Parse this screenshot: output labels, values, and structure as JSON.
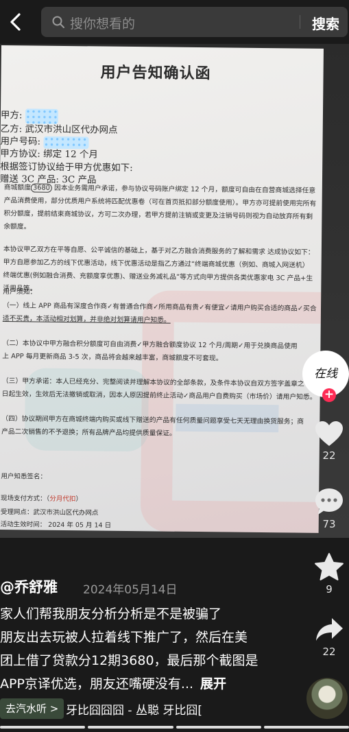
{
  "topbar": {
    "back_icon": "chevron-left-icon",
    "search_placeholder": "搜你想看的",
    "search_button": "搜索"
  },
  "document": {
    "title": "用户告知确认函",
    "party_a_label": "甲方:",
    "party_b": "乙方: 武汉市洪山区代办网点",
    "user_no_label": "用户号码:",
    "party_a_agreement": "甲方协议: 绑定 12 个月",
    "basis": "根据签订协议给于甲方优惠如下:",
    "gift": "赠送 3C 产品: 3C 产品",
    "p1_a": "商城额度",
    "p1_amount": "3680",
    "p1_b": "因本业务需用户承诺，参与协议号码账户绑定 12 个月，额度可自由在自营商城选择任意",
    "p1_c": "产品消费使用，部分优质用户系统将匹配优惠卷（可在首页抵扣部分额度使用）。甲方亦可提前使用完所有",
    "p1_d": "积分额度，提前结束商城协议，方可二次办理，若甲方提前注销或变更及注销号码则视为自动放弃所有剩",
    "p1_e": "余额度。",
    "p2_a": "本协议甲乙双方在平等自愿、公平诚信的基础上，基于对乙方融合消费服务的了解和需求  达成协议如下：",
    "p2_b": "甲方自愿参加乙方的线下优惠活动，线下优惠活动是指乙方通过“终端商城优惠（例如、商城入网送机）",
    "p2_c": "终端优惠(例如融合消费、充额度享优惠)、赠送业务减礼品”等方式向甲方提供各类优惠家电 3C 产品+生",
    "p2_d": "活用品等。",
    "notice_title": "用户须知：",
    "n1_a": "（一）线上 APP 商品有深度合作商✓有普通合作商✓所用商品有贵✓有便宜✓请用户购买合适的商品✓买合",
    "n1_b": "适不买贵，本活动相对划算，并非绝对划算请用户知悉。",
    "n2_a": "（二）本协议中甲方融合积分额度可自由消费✓甲方融合额度协议 12 个月/周期✓用于兑换商品使用",
    "n2_b": "上 APP 每月更新商品  3-5 次，商品将会越来越丰富，商城额度不可套现。",
    "n3_a": "（三）甲方承诺：本人已经充分、完整阅读并理解本协议的全部条款，及条件本协议自双方签字盖章之",
    "n3_b": "日起生效，生效后无法撤销或取消，因本人原因提前终止活动✓商品用户自费购买（市场价）请用户知悉。",
    "n4_a": "（四）协议期间甲方在商城终端内购买或线下赠送的产品有任何质量问题享受七天无理由换货服务；商",
    "n4_b": "产品二次销售的不予退换；所有品牌产品均提供质量保证。",
    "sign_label": "用户知悉签名：",
    "pay_label": "现场支付方式：（",
    "pay_value": "分月代扣",
    "pay_end": "）",
    "venue": "受理网点：武汉市洪山区代办网点",
    "effective": "活动生效时间：  2024 年 05 月 14 日"
  },
  "actions": {
    "avatar_text": "在线",
    "follow": "+",
    "like_count": "22",
    "comment_count": "73",
    "favorite_count": "9",
    "share_count": "22"
  },
  "post": {
    "author": "@乔舒雅",
    "date": "2024年05月14日",
    "desc_1": "家人们帮我朋友分析分析是不是被骗了",
    "desc_2": "朋友出去玩被人拉着线下推广了，然后在美",
    "desc_3": "团上借了贷款分12期3680，最后那个截图是",
    "desc_4": "APP京译优选，朋友还嘴硬没有...",
    "expand": "展开"
  },
  "music": {
    "tag": "去汽水听 >",
    "name": "牙比囧囧囧 - 丛聪   牙比囧["
  },
  "progress": {
    "segments": 4,
    "current": 4
  }
}
